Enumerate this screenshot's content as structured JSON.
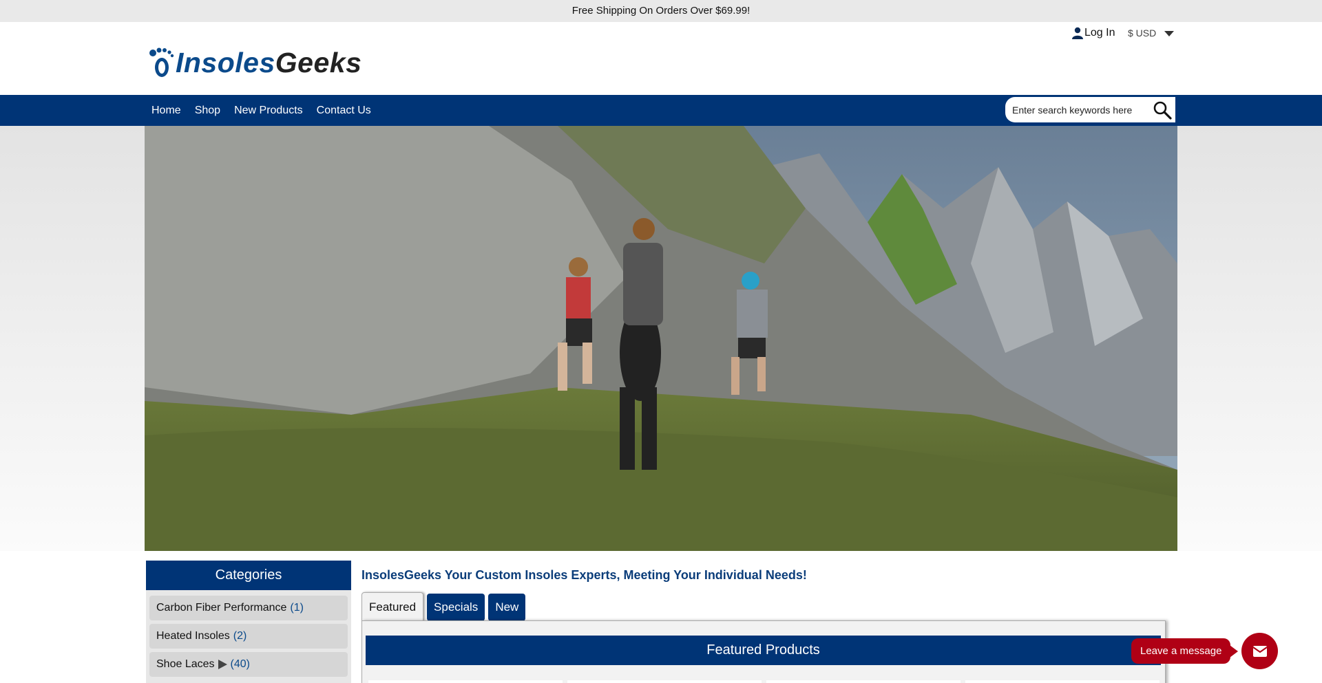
{
  "announcement": "Free Shipping On Orders Over $69.99!",
  "header": {
    "logo_part1": "Insoles",
    "logo_part2": "Geeks",
    "login_label": "Log In",
    "currency_label": "$ USD"
  },
  "nav": {
    "items": [
      "Home",
      "Shop",
      "New Products",
      "Contact Us"
    ],
    "search_placeholder": "Enter search keywords here"
  },
  "hero": {
    "icon": "mountain-trail-runners-photo"
  },
  "sidebar": {
    "title": "Categories",
    "items": [
      {
        "label": "Carbon Fiber Performance",
        "count": "(1)"
      },
      {
        "label": "Heated Insoles",
        "count": "(2)"
      },
      {
        "label": "Shoe Laces",
        "count": "(40)"
      }
    ]
  },
  "main": {
    "tagline": "InsolesGeeks Your Custom Insoles Experts, Meeting Your Individual Needs!",
    "tabs": [
      "Featured",
      "Specials",
      "New"
    ],
    "panel_title": "Featured Products"
  },
  "chat": {
    "label": "Leave a message",
    "icon": "mail-icon"
  },
  "colors": {
    "brand_blue": "#003476",
    "chat_red": "#b00015",
    "topbar_gray": "#e9e9e9"
  }
}
